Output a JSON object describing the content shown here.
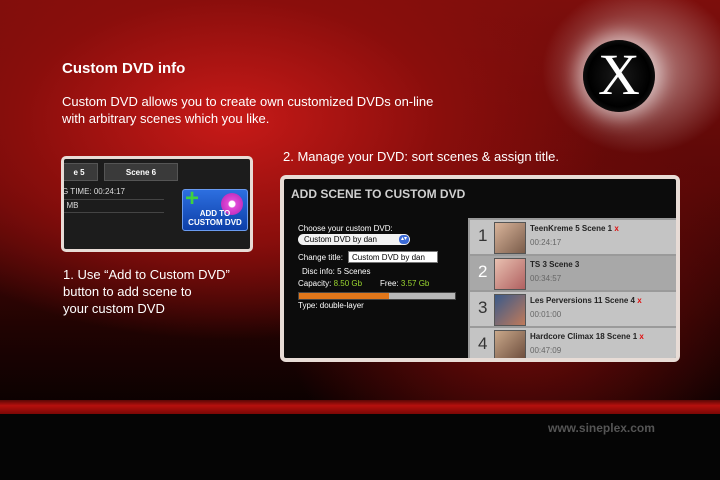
{
  "page": {
    "title": "Custom DVD info",
    "intro_lines": [
      "Custom DVD allows you to create own customized DVDs on-line",
      "with arbitrary scenes which you like."
    ],
    "site": "www.sineplex.com"
  },
  "logo": {
    "letter": "X"
  },
  "step1": {
    "lines": [
      "1. Use “Add to Custom DVD”",
      "button to add scene to",
      "your custom DVD"
    ],
    "tabs": [
      "e 5",
      "Scene 6"
    ],
    "info_time": "G TIME: 00:24:17",
    "info_size": ": MB",
    "button_lines": [
      "ADD TO",
      "CUSTOM DVD"
    ]
  },
  "step2": {
    "caption": "2. Manage your DVD: sort scenes & assign title.",
    "panel_title": "ADD SCENE TO CUSTOM DVD",
    "choose_label": "Choose your custom DVD:",
    "select_value": "Custom DVD by dan",
    "change_title_label": "Change title:",
    "title_value": "Custom DVD by dan",
    "disc_info": "Disc info: 5 Scenes",
    "capacity_label": "Capacity:",
    "capacity_value": "8.50 Gb",
    "free_label": "Free:",
    "free_value": "3.57 Gb",
    "used_fraction": 0.58,
    "type": "Type: double-layer",
    "scenes": [
      {
        "num": "1",
        "name": "TeenKreme 5 Scene 1",
        "remove": "x",
        "time": "00:24:17"
      },
      {
        "num": "2",
        "name": "TS 3 Scene 3",
        "remove": "",
        "time": "00:34:57"
      },
      {
        "num": "3",
        "name": "Les Perversions 11 Scene 4",
        "remove": "x",
        "time": "00:01:00"
      },
      {
        "num": "4",
        "name": "Hardcore Climax 18 Scene 1",
        "remove": "x",
        "time": "00:47:09"
      }
    ]
  },
  "colors": {
    "accent_red": "#b5100d",
    "capacity_green": "#9ad62f",
    "bar_orange": "#e0761a",
    "button_blue": "#1f57c8"
  }
}
